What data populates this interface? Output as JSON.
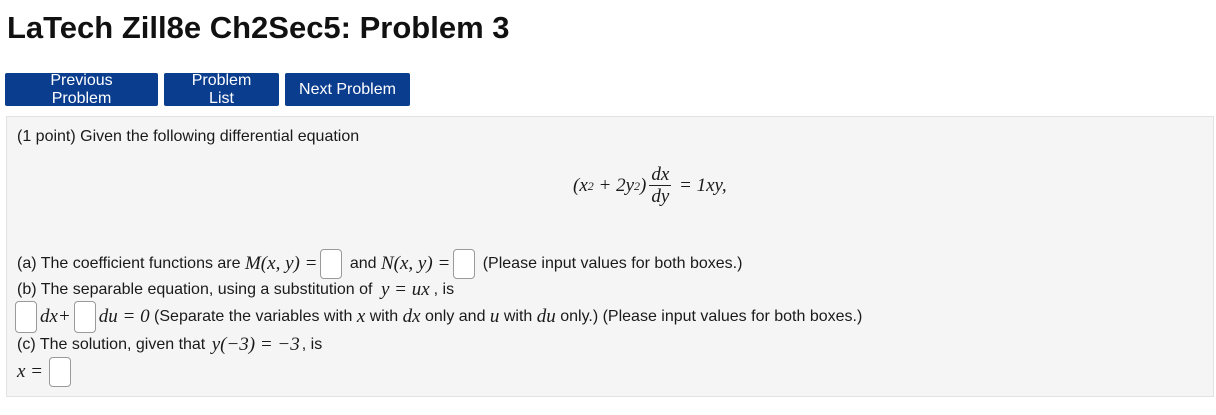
{
  "page": {
    "title": "LaTech Zill8e Ch2Sec5: Problem 3"
  },
  "nav": {
    "previous": "Previous Problem",
    "list": "Problem List",
    "next": "Next Problem"
  },
  "problem": {
    "intro": "(1 point) Given the following differential equation",
    "equation": {
      "lhs": "(x",
      "exp1": "2",
      "mid": " + 2y",
      "exp2": "2",
      "close": ")",
      "frac_num": "dx",
      "frac_den": "dy",
      "rhs": " = 1xy,"
    },
    "part_a": {
      "lead": "(a) The coefficient functions are ",
      "m": "M(x, y) =",
      "and": " and ",
      "n": "N(x, y) =",
      "note": " (Please input values for both boxes.)"
    },
    "part_b": {
      "lead": "(b) The separable equation, using a substitution of ",
      "sub": "y = ux",
      "tail": ", is"
    },
    "part_b2": {
      "dx": "dx+",
      "du_eq": "du = 0",
      "text1": " (Separate the variables with ",
      "x": "x",
      "with": " with ",
      "dx2": "dx",
      "text2": " only and ",
      "u": "u",
      "with2": " with ",
      "du2": "du",
      "text3": " only.) (Please input values for both boxes.)"
    },
    "part_c": {
      "lead": "(c) The solution, given that ",
      "cond": "y(−3) = −3",
      "tail": ", is"
    },
    "answer": {
      "lhs": "x ="
    }
  }
}
